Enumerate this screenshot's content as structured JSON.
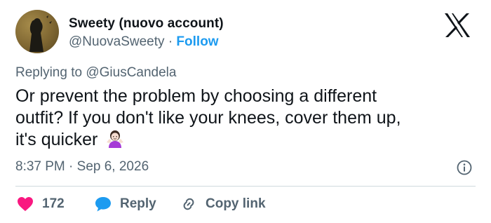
{
  "author": {
    "name": "Sweety (nuovo account)",
    "handle": "@NuovaSweety",
    "separator": "·",
    "follow_label": "Follow"
  },
  "reply": {
    "prefix": "Replying to ",
    "target": "@GiusCandela"
  },
  "tweet": {
    "line1": "Or prevent the problem by choosing a different",
    "line2": "outfit? If you don't like your knees, cover them up,",
    "line3": "it's quicker"
  },
  "meta": {
    "time": "8:37 PM",
    "separator": "·",
    "date": "Sep 6, 2026"
  },
  "actions": {
    "like_count": "172",
    "reply_label": "Reply",
    "copy_label": "Copy link"
  },
  "icons": {
    "logo": "x-logo-icon",
    "emoji": "person-shrugging-emoji-icon",
    "info": "info-icon",
    "like": "heart-icon",
    "reply": "reply-bubble-icon",
    "copy": "link-icon"
  },
  "colors": {
    "like": "#f91880",
    "reply": "#1d9bf0",
    "follow": "#1d9bf0",
    "secondary_text": "#536471",
    "divider": "#cfd9de"
  }
}
